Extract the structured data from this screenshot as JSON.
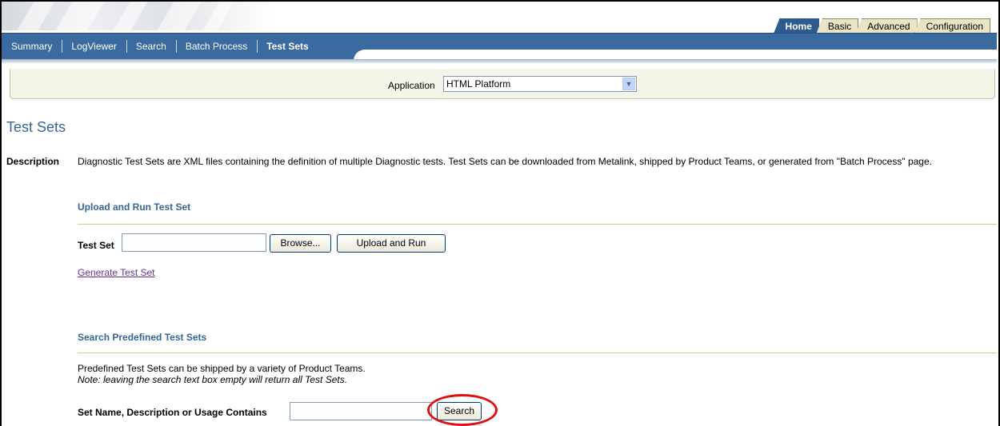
{
  "global_tabs": [
    {
      "label": "Home",
      "active": true
    },
    {
      "label": "Basic",
      "active": false
    },
    {
      "label": "Advanced",
      "active": false
    },
    {
      "label": "Configuration",
      "active": false
    }
  ],
  "nav_tabs": [
    {
      "label": "Summary",
      "active": false
    },
    {
      "label": "LogViewer",
      "active": false
    },
    {
      "label": "Search",
      "active": false
    },
    {
      "label": "Batch Process",
      "active": false
    },
    {
      "label": "Test Sets",
      "active": true
    }
  ],
  "application": {
    "label": "Application",
    "selected": "HTML Platform"
  },
  "page_title": "Test Sets",
  "description": {
    "label": "Description",
    "text": "Diagnostic Test Sets are XML files containing the definition of multiple Diagnostic tests. Test Sets can be downloaded from Metalink, shipped by Product Teams, or generated from \"Batch Process\" page."
  },
  "upload_section": {
    "heading": "Upload and Run Test Set",
    "field_label": "Test Set",
    "field_value": "",
    "browse_label": "Browse...",
    "upload_label": "Upload and Run",
    "generate_link": "Generate Test Set"
  },
  "search_section": {
    "heading": "Search Predefined Test Sets",
    "info": "Predefined Test Sets can be shipped by a variety of Product Teams.",
    "note": "Note: leaving the search text box empty will return all Test Sets.",
    "field_label": "Set Name, Description or Usage Contains",
    "field_value": "",
    "search_label": "Search"
  },
  "colors": {
    "accent": "#336699",
    "navbar": "#3b6aa0",
    "highlight_circle": "#dd1111"
  }
}
